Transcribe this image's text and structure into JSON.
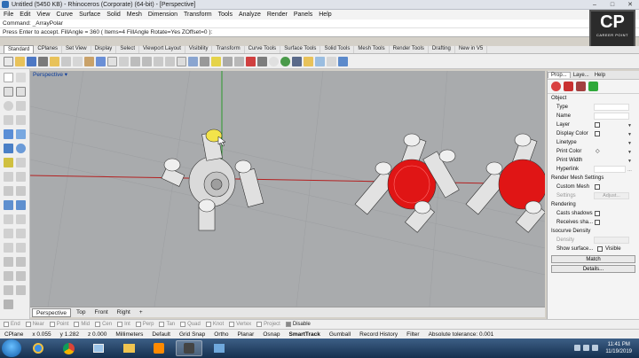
{
  "window": {
    "title": "Untitled (5450 KB) - Rhinoceros (Corporate) (64-bit) - [Perspective]",
    "controls": [
      "–",
      "□",
      "✕"
    ]
  },
  "menu": [
    "File",
    "Edit",
    "View",
    "Curve",
    "Surface",
    "Solid",
    "Mesh",
    "Dimension",
    "Transform",
    "Tools",
    "Analyze",
    "Render",
    "Panels",
    "Help"
  ],
  "command": {
    "history": "Command: _ArrayPolar",
    "prompt": "Press Enter to accept. FillAngle = 360 ( Items=4  FillAngle  Rotate=Yes  ZOffset=0 ):"
  },
  "logo": {
    "big": "CP",
    "small": "CAREER POINT"
  },
  "toolbar_tabs": [
    "Standard",
    "CPlanes",
    "Set View",
    "Display",
    "Select",
    "Viewport Layout",
    "Visibility",
    "Transform",
    "Curve Tools",
    "Surface Tools",
    "Solid Tools",
    "Mesh Tools",
    "Render Tools",
    "Drafting",
    "New in V5"
  ],
  "viewport": {
    "title": "Perspective",
    "tabs": [
      "Perspective",
      "Top",
      "Front",
      "Right"
    ],
    "add_tab": "+"
  },
  "properties_panel": {
    "tabs": [
      "Prop...",
      "Laye...",
      "Help"
    ],
    "section_object": "Object",
    "rows": [
      {
        "label": "Type"
      },
      {
        "label": "Name"
      },
      {
        "label": "Layer"
      },
      {
        "label": "Display Color"
      },
      {
        "label": "Linetype"
      },
      {
        "label": "Print Color"
      },
      {
        "label": "Print Width"
      },
      {
        "label": "Hyperlink"
      }
    ],
    "section_render_mesh": "Render Mesh Settings",
    "custom_mesh": "Custom Mesh",
    "settings": "Settings",
    "adjust_button": "Adjust...",
    "section_rendering": "Rendering",
    "casts_shadows": "Casts shadows",
    "receives_shadows": "Receives sha...",
    "section_isocurve": "Isocurve Density",
    "density": "Density",
    "show_surface": "Show surface...",
    "visible": "Visible",
    "match_button": "Match",
    "details_button": "Details..."
  },
  "osnap": [
    "End",
    "Near",
    "Point",
    "Mid",
    "Cen",
    "Int",
    "Perp",
    "Tan",
    "Quad",
    "Knot",
    "Vertex",
    "Project",
    "Disable"
  ],
  "status": {
    "cplane": "CPlane",
    "x": "x 0.055",
    "y": "y 1.282",
    "z": "z 0.000",
    "units": "Millimeters",
    "layer": "Default",
    "grid_snap": "Grid Snap",
    "ortho": "Ortho",
    "planar": "Planar",
    "osnap": "Osnap",
    "smarttrack": "SmartTrack",
    "gumball": "Gumball",
    "record_history": "Record History",
    "filter": "Filter",
    "tolerance": "Absolute tolerance: 0.001"
  },
  "taskbar": {
    "time": "11:41 PM",
    "date": "11/19/2019"
  },
  "colors": {
    "viewport_bg": "#a9abad",
    "x_axis": "#b42020",
    "y_axis": "#2c9a2c",
    "selected_highlight": "#f3e34a",
    "red_sphere": "#e01515"
  }
}
